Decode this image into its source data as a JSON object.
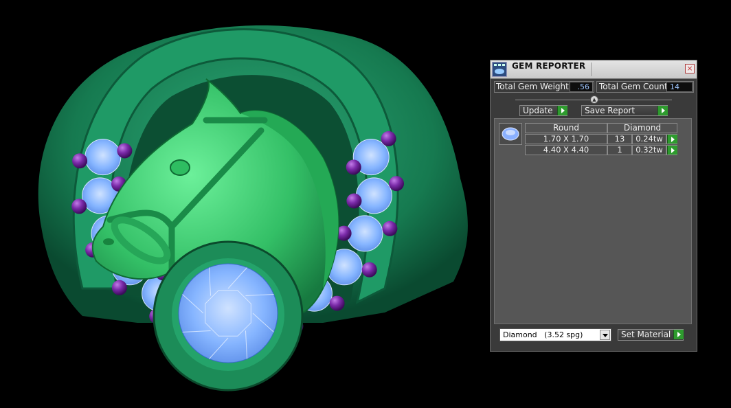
{
  "panel": {
    "title": "GEM REPORTER",
    "close_glyph": "×",
    "total_gem_weight_label": "Total Gem Weight",
    "total_gem_weight_value": ".56",
    "total_gem_count_label": "Total Gem Count",
    "total_gem_count_value": "14",
    "slider_glyph": "▲",
    "update_label": "Update",
    "save_report_label": "Save Report",
    "table": {
      "headers": [
        "Round",
        "Diamond"
      ],
      "rows": [
        {
          "size": "1.70 X 1.70",
          "count": "13",
          "weight": "0.24tw"
        },
        {
          "size": "4.40 X 4.40",
          "count": "1",
          "weight": "0.32tw"
        }
      ]
    },
    "material_selected": "Diamond   (3.52 spg)",
    "set_material_label": "Set Material"
  },
  "colors": {
    "ring_green": "#1e8f5e",
    "horse_green": "#3fcf73",
    "diamond_blue": "#7fb2ff",
    "amethyst_purple": "#6a1d9a",
    "button_green": "#2e9b2e",
    "value_text": "#9ec6ff"
  },
  "icons": [
    "gem-reporter-icon",
    "close-icon",
    "play-arrow-icon",
    "dropdown-arrow-icon",
    "gem-thumbnail-icon"
  ]
}
